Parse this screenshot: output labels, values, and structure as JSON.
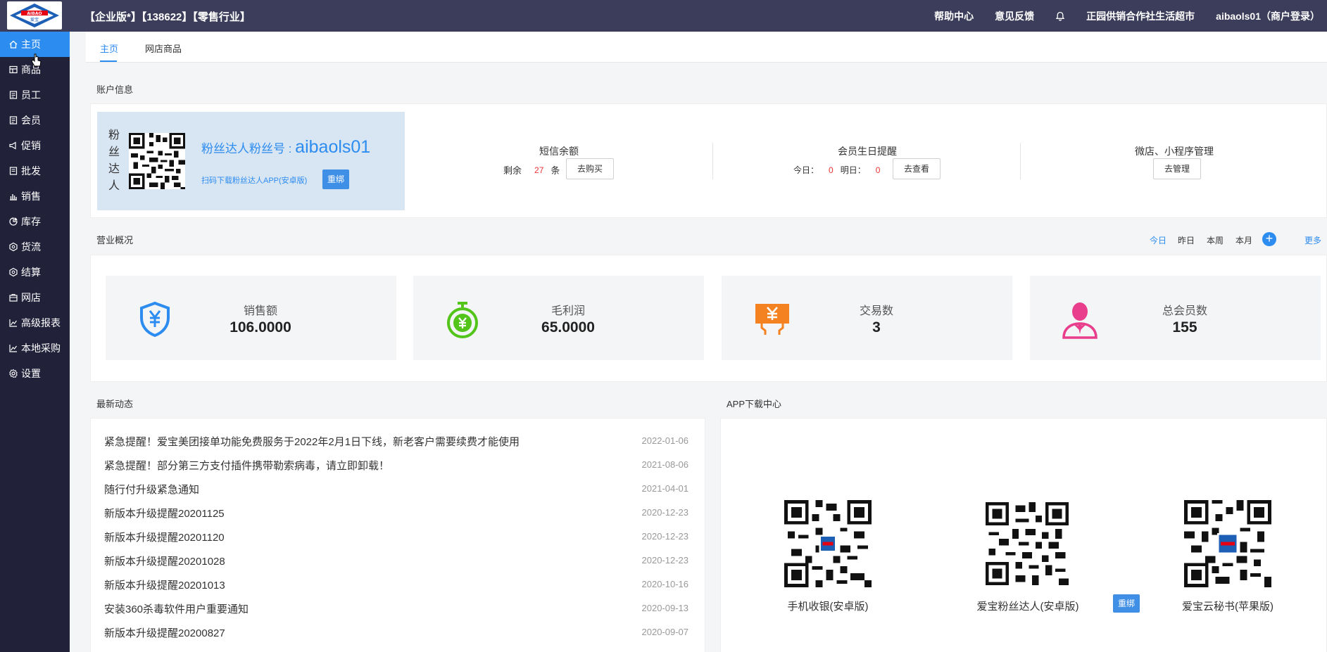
{
  "header": {
    "logo_text_top": "AIBAO",
    "logo_text_bottom": "爱宝",
    "edition": "【企业版*】【138622】【零售行业】",
    "help": "帮助中心",
    "feedback": "意见反馈",
    "store": "正园供销合作社生活超市",
    "user": "aibaols01（商户登录）"
  },
  "sidebar": {
    "items": [
      {
        "label": "主页",
        "icon": "home-icon"
      },
      {
        "label": "商品",
        "icon": "goods-icon"
      },
      {
        "label": "员工",
        "icon": "staff-icon"
      },
      {
        "label": "会员",
        "icon": "member-icon"
      },
      {
        "label": "促销",
        "icon": "promo-icon"
      },
      {
        "label": "批发",
        "icon": "wholesale-icon"
      },
      {
        "label": "销售",
        "icon": "sales-chart-icon"
      },
      {
        "label": "库存",
        "icon": "stock-icon"
      },
      {
        "label": "货流",
        "icon": "logistics-icon"
      },
      {
        "label": "结算",
        "icon": "settle-icon"
      },
      {
        "label": "网店",
        "icon": "shop-icon"
      },
      {
        "label": "高级报表",
        "icon": "report-icon"
      },
      {
        "label": "本地采购",
        "icon": "purchase-icon"
      },
      {
        "label": "设置",
        "icon": "settings-icon"
      }
    ]
  },
  "tabs": [
    "主页",
    "网店商品"
  ],
  "account": {
    "section_title": "账户信息",
    "vertical_label": [
      "粉",
      "丝",
      "达",
      "人"
    ],
    "title_prefix": "粉丝达人粉丝号 : ",
    "title_id": "aibaols01",
    "subtitle": "扫码下载粉丝达人APP(安卓版)",
    "rebind": "重绑",
    "sms": {
      "title": "短信余额",
      "prefix": "剩余",
      "count": "27",
      "unit": "条",
      "button": "去购买"
    },
    "birthday": {
      "title": "会员生日提醒",
      "today_label": "今日：",
      "today": "0",
      "tomorrow_label": "明日：",
      "tomorrow": "0",
      "button": "去查看"
    },
    "mini": {
      "title": "微店、小程序管理",
      "button": "去管理"
    }
  },
  "business": {
    "section_title": "营业概况",
    "periods": [
      "今日",
      "昨日",
      "本周",
      "本月"
    ],
    "more": "更多",
    "stats": [
      {
        "label": "销售额",
        "value": "106.0000",
        "icon": "shield-yen-icon",
        "color": "#2d8cf0"
      },
      {
        "label": "毛利润",
        "value": "65.0000",
        "icon": "stopwatch-yen-icon",
        "color": "#52c41a"
      },
      {
        "label": "交易数",
        "value": "3",
        "icon": "card-yen-icon",
        "color": "#f58220"
      },
      {
        "label": "总会员数",
        "value": "155",
        "icon": "person-icon",
        "color": "#e83e8c"
      }
    ]
  },
  "news": {
    "section_title": "最新动态",
    "items": [
      {
        "title": "紧急提醒！爱宝美团接单功能免费服务于2022年2月1日下线，新老客户需要续费才能使用",
        "date": "2022-01-06"
      },
      {
        "title": "紧急提醒！部分第三方支付插件携带勒索病毒，请立即卸载！",
        "date": "2021-08-06"
      },
      {
        "title": "随行付升级紧急通知",
        "date": "2021-04-01"
      },
      {
        "title": "新版本升级提醒20201125",
        "date": "2020-12-23"
      },
      {
        "title": "新版本升级提醒20201120",
        "date": "2020-12-23"
      },
      {
        "title": "新版本升级提醒20201028",
        "date": "2020-12-23"
      },
      {
        "title": "新版本升级提醒20201013",
        "date": "2020-10-16"
      },
      {
        "title": "安装360杀毒软件用户重要通知",
        "date": "2020-09-13"
      },
      {
        "title": "新版本升级提醒20200827",
        "date": "2020-09-07"
      }
    ]
  },
  "apps": {
    "section_title": "APP下载中心",
    "items": [
      {
        "label": "手机收银(安卓版)"
      },
      {
        "label": "爱宝粉丝达人(安卓版)"
      },
      {
        "label": "爱宝云秘书(苹果版)"
      }
    ],
    "rebind": "重绑"
  }
}
